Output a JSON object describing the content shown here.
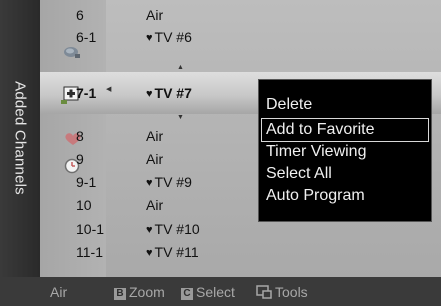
{
  "side_title": "Added Channels",
  "rows": [
    {
      "num": "6",
      "name": "Air",
      "fav": false
    },
    {
      "num": "6-1",
      "name": "TV #6",
      "fav": true
    },
    {
      "num": "7-1",
      "name": "TV #7",
      "fav": true
    },
    {
      "num": "8",
      "name": "Air",
      "fav": false
    },
    {
      "num": "9",
      "name": "Air",
      "fav": false
    },
    {
      "num": "9-1",
      "name": "TV #9",
      "fav": true
    },
    {
      "num": "10",
      "name": "Air",
      "fav": false
    },
    {
      "num": "10-1",
      "name": "TV #10",
      "fav": true
    },
    {
      "num": "11-1",
      "name": "TV #11",
      "fav": true
    }
  ],
  "heart_glyph": "♥",
  "menu": {
    "items": [
      "Delete",
      "Add to Favorite",
      "Timer Viewing",
      "Select All",
      "Auto Program"
    ]
  },
  "bottom_bar": {
    "source": "Air",
    "zoom_key": "B",
    "zoom_label": "Zoom",
    "select_key": "C",
    "select_label": "Select",
    "tools_label": "Tools"
  },
  "icons": [
    "antenna-icon",
    "add-channel-icon",
    "favorite-heart-icon",
    "timer-clock-icon",
    "tools-icon"
  ]
}
